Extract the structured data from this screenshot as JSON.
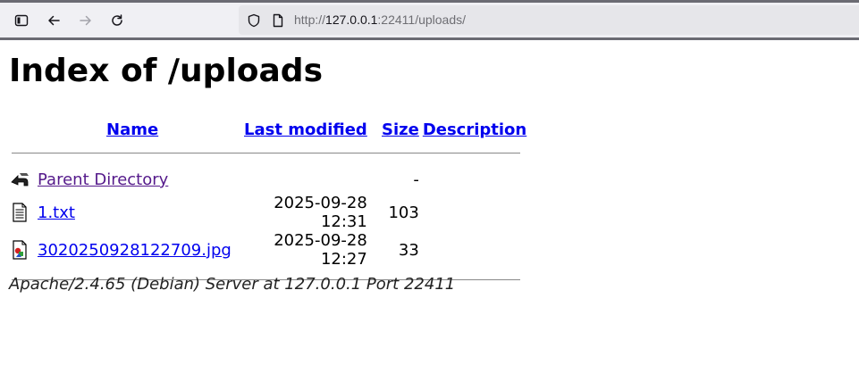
{
  "browser": {
    "url_scheme": "http://",
    "url_host": "127.0.0.1",
    "url_rest": ":22411/uploads/"
  },
  "page": {
    "title": "Index of /uploads",
    "columns": {
      "name": "Name",
      "last_modified": "Last modified",
      "size": "Size",
      "description": "Description"
    },
    "parent": {
      "name": "Parent Directory",
      "size": "-"
    },
    "rows": [
      {
        "name": "1.txt",
        "modified": "2025-09-28 12:31",
        "size": "103",
        "icon": "text-file-icon"
      },
      {
        "name": "3020250928122709.jpg",
        "modified": "2025-09-28 12:27",
        "size": "33",
        "icon": "image-file-icon"
      }
    ],
    "footer": "Apache/2.4.65 (Debian) Server at 127.0.0.1 Port 22411"
  }
}
